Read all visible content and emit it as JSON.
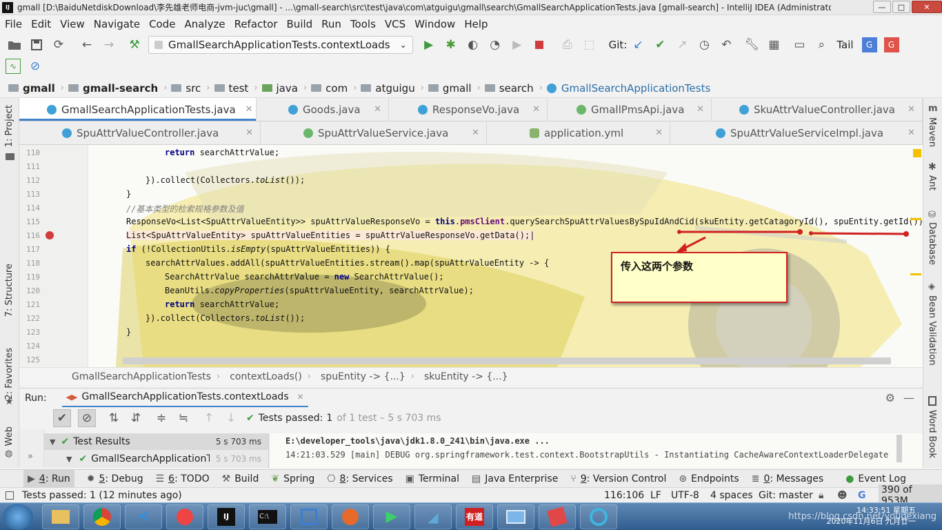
{
  "window": {
    "title": "gmall [D:\\BaiduNetdiskDownload\\李先雄老师电商-jvm-juc\\gmall] - ...\\gmall-search\\src\\test\\java\\com\\atguigu\\gmall\\search\\GmallSearchApplicationTests.java [gmall-search] - IntelliJ IDEA (Administrator)",
    "app_icon": "IJ"
  },
  "menu": [
    "File",
    "Edit",
    "View",
    "Navigate",
    "Code",
    "Analyze",
    "Refactor",
    "Build",
    "Run",
    "Tools",
    "VCS",
    "Window",
    "Help"
  ],
  "toolbar": {
    "run_config": "GmallSearchApplicationTests.contextLoads",
    "git_label": "Git:",
    "tail_label": "Tail"
  },
  "breadcrumbs": [
    "gmall",
    "gmall-search",
    "src",
    "test",
    "java",
    "com",
    "atguigu",
    "gmall",
    "search",
    "GmallSearchApplicationTests"
  ],
  "tabs_row1": [
    {
      "label": "GmallSearchApplicationTests.java",
      "kind": "class",
      "active": true
    },
    {
      "label": "Goods.java",
      "kind": "class"
    },
    {
      "label": "ResponseVo.java",
      "kind": "class"
    },
    {
      "label": "GmallPmsApi.java",
      "kind": "interface"
    },
    {
      "label": "SkuAttrValueController.java",
      "kind": "class"
    }
  ],
  "tabs_row2": [
    {
      "label": "SpuAttrValueController.java",
      "kind": "class"
    },
    {
      "label": "SpuAttrValueService.java",
      "kind": "interface"
    },
    {
      "label": "application.yml",
      "kind": "yaml"
    },
    {
      "label": "SpuAttrValueServiceImpl.java",
      "kind": "class"
    }
  ],
  "left_tools": [
    "1: Project",
    "7: Structure",
    "2: Favorites",
    "Web"
  ],
  "right_tools": [
    "Maven",
    "Ant",
    "Database",
    "Bean Validation",
    "Word Book"
  ],
  "code": {
    "line_numbers": [
      "110",
      "111",
      "112",
      "113",
      "114",
      "115",
      "116",
      "117",
      "118",
      "119",
      "120",
      "121",
      "122",
      "123",
      "124",
      "125"
    ],
    "breakpoint_line": "116",
    "callout_text": "传入这两个参数"
  },
  "editor_breadcrumb": [
    "GmallSearchApplicationTests",
    "contextLoads()",
    "spuEntity -> {...}",
    "skuEntity -> {...}"
  ],
  "run_panel": {
    "label": "Run:",
    "config": "GmallSearchApplicationTests.contextLoads",
    "tests_passed_label": "Tests passed:",
    "tests_passed_count": "1",
    "tests_detail": "of 1 test – 5 s 703 ms",
    "tree": [
      {
        "label": "Test Results",
        "time": "5 s 703 ms"
      },
      {
        "label": "GmallSearchApplicationT",
        "time": "5 s 703 ms"
      }
    ],
    "console": [
      "E:\\developer_tools\\java\\jdk1.8.0_241\\bin\\java.exe ...",
      "14:21:03.529 [main] DEBUG org.springframework.test.context.BootstrapUtils - Instantiating CacheAwareContextLoaderDelegate"
    ]
  },
  "tool_windows": [
    {
      "key": "4",
      "label": ": Run"
    },
    {
      "key": "5",
      "label": ": Debug"
    },
    {
      "key": "6",
      "label": ": TODO"
    },
    {
      "key": "",
      "label": "Build"
    },
    {
      "key": "",
      "label": "Spring"
    },
    {
      "key": "8",
      "label": ": Services"
    },
    {
      "key": "",
      "label": "Terminal"
    },
    {
      "key": "",
      "label": "Java Enterprise"
    },
    {
      "key": "9",
      "label": ": Version Control"
    },
    {
      "key": "",
      "label": "Endpoints"
    },
    {
      "key": "0",
      "label": ": Messages"
    },
    {
      "key": "",
      "label": "Event Log"
    }
  ],
  "status": {
    "message": "Tests passed: 1 (12 minutes ago)",
    "position": "116:106",
    "line_sep": "LF",
    "encoding": "UTF-8",
    "indent": "4 spaces",
    "vcs": "Git: master",
    "memory": "390 of 953M"
  },
  "taskbar": {
    "time": "14:33:51 星期五",
    "date": "2020年11月6日 九月廿一",
    "watermark": "https://blog.csdn.net/youdexiang"
  },
  "colors": {
    "accent": "#4083c9",
    "run_green": "#3d9a3d",
    "breakpoint": "#d23b3b",
    "callout_border": "#d02020",
    "callout_bg": "#ffffc8"
  }
}
